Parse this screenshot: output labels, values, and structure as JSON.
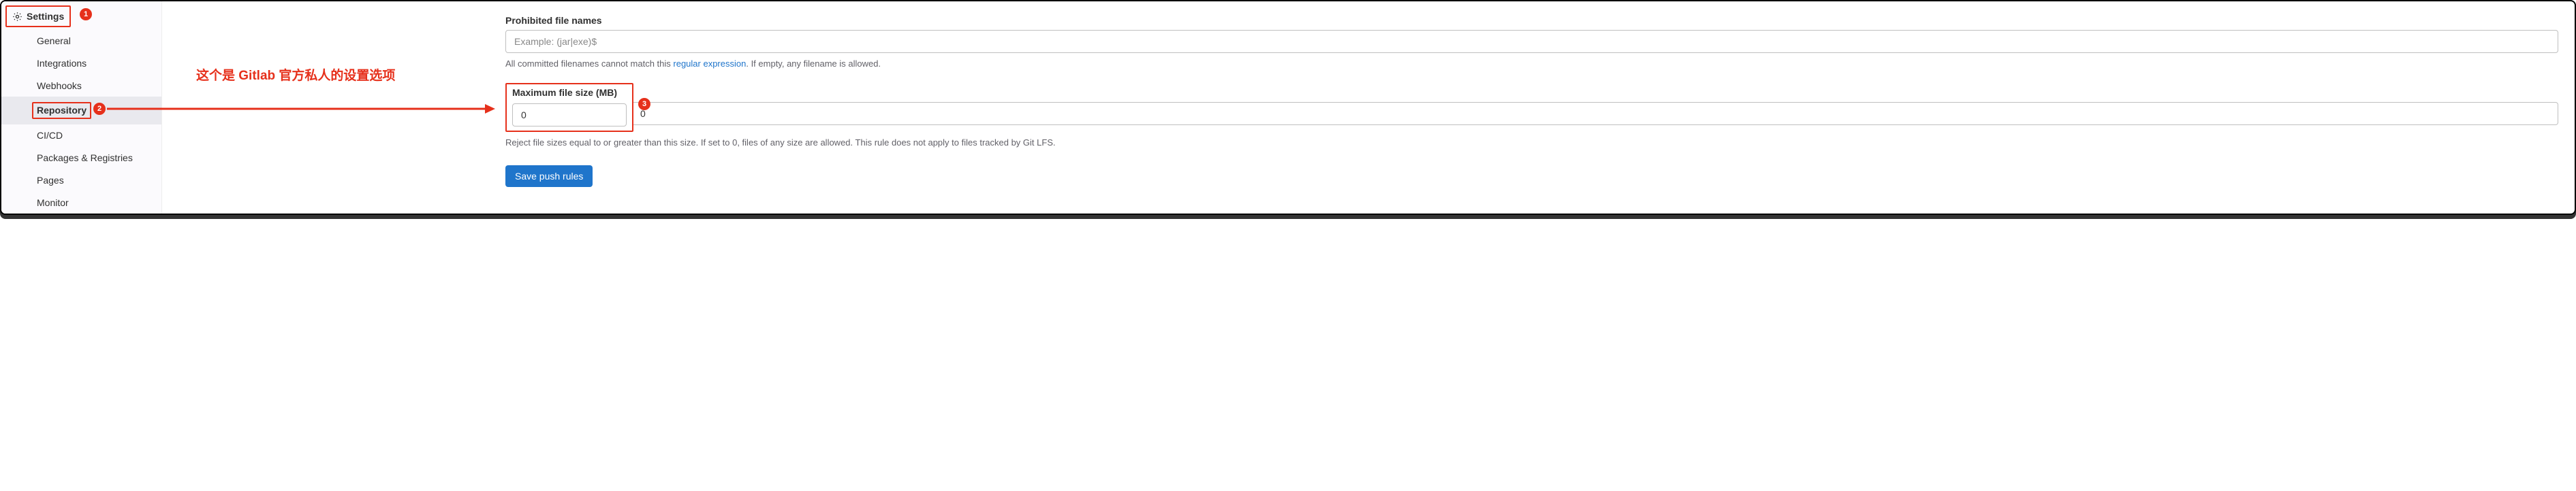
{
  "sidebar": {
    "header": "Settings",
    "items": [
      {
        "label": "General"
      },
      {
        "label": "Integrations"
      },
      {
        "label": "Webhooks"
      },
      {
        "label": "Repository",
        "active": true
      },
      {
        "label": "CI/CD"
      },
      {
        "label": "Packages & Registries"
      },
      {
        "label": "Pages"
      },
      {
        "label": "Monitor"
      }
    ]
  },
  "annotations": {
    "middle_text": "这个是 Gitlab 官方私人的设置选项",
    "badge1": "1",
    "badge2": "2",
    "badge3": "3"
  },
  "main": {
    "prohibited": {
      "label": "Prohibited file names",
      "placeholder": "Example: (jar|exe)$",
      "help_pre": "All committed filenames cannot match this ",
      "help_link": "regular expression",
      "help_post": ". If empty, any filename is allowed."
    },
    "maxsize": {
      "label": "Maximum file size (MB)",
      "value": "0",
      "help": "Reject file sizes equal to or greater than this size. If set to 0, files of any size are allowed. This rule does not apply to files tracked by Git LFS."
    },
    "save_btn": "Save push rules"
  }
}
